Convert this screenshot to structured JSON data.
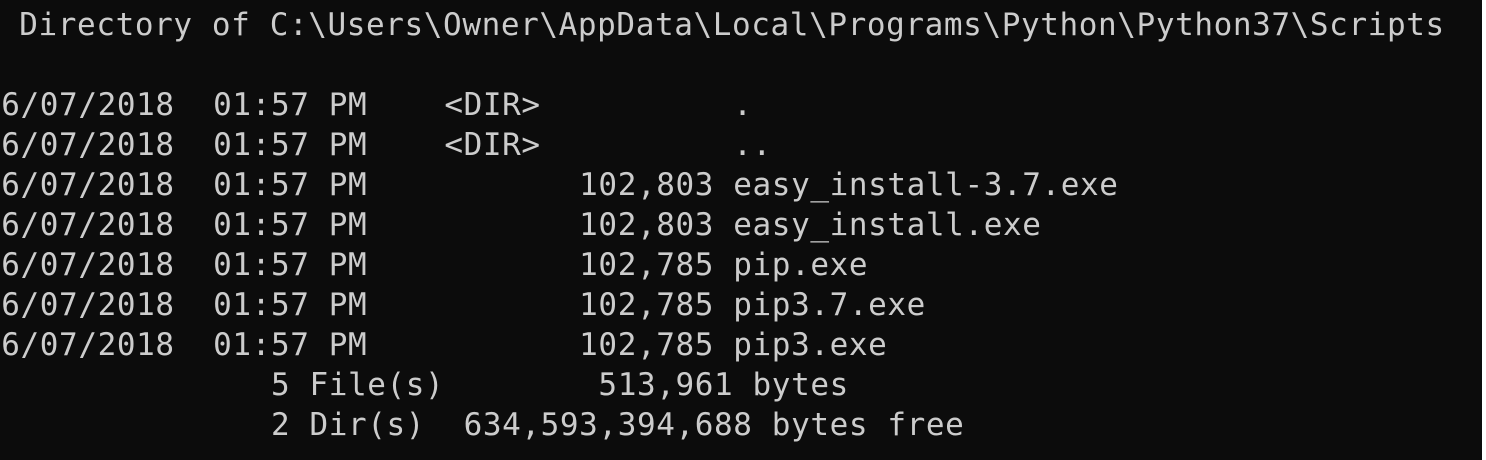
{
  "console": {
    "header": " Directory of C:\\Users\\Owner\\AppData\\Local\\Programs\\Python\\Python37\\Scripts",
    "blank": "",
    "entries": [
      {
        "text": "06/07/2018  01:57 PM    <DIR>          ."
      },
      {
        "text": "06/07/2018  01:57 PM    <DIR>          .."
      },
      {
        "text": "06/07/2018  01:57 PM           102,803 easy_install-3.7.exe"
      },
      {
        "text": "06/07/2018  01:57 PM           102,803 easy_install.exe"
      },
      {
        "text": "06/07/2018  01:57 PM           102,785 pip.exe"
      },
      {
        "text": "06/07/2018  01:57 PM           102,785 pip3.7.exe"
      },
      {
        "text": "06/07/2018  01:57 PM           102,785 pip3.exe"
      }
    ],
    "summary_files": "               5 File(s)        513,961 bytes",
    "summary_dirs": "               2 Dir(s)  634,593,394,688 bytes free"
  },
  "colors": {
    "background": "#0c0c0c",
    "foreground": "#cccccc"
  }
}
